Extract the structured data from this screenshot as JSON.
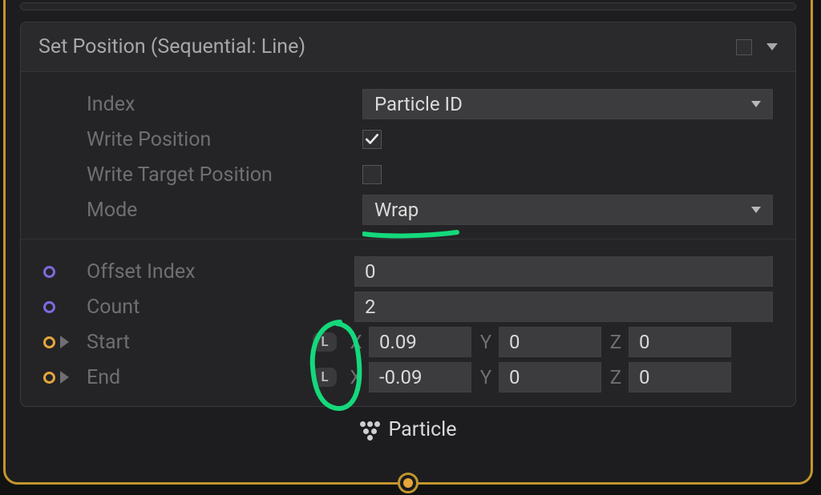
{
  "header": {
    "title": "Set Position (Sequential: Line)",
    "enabled": false
  },
  "props": {
    "index": {
      "label": "Index",
      "value": "Particle ID"
    },
    "write_position": {
      "label": "Write Position",
      "value": true
    },
    "write_target_position": {
      "label": "Write Target Position",
      "value": false
    },
    "mode": {
      "label": "Mode",
      "value": "Wrap"
    }
  },
  "inputs": {
    "offset_index": {
      "label": "Offset Index",
      "value": "0"
    },
    "count": {
      "label": "Count",
      "value": "2"
    },
    "start": {
      "label": "Start",
      "badge": "L",
      "x": "0.09",
      "y": "0",
      "z": "0"
    },
    "end": {
      "label": "End",
      "badge": "L",
      "x": "-0.09",
      "y": "0",
      "z": "0"
    }
  },
  "vec_axes": {
    "x": "X",
    "y": "Y",
    "z": "Z"
  },
  "footer": {
    "label": "Particle"
  }
}
